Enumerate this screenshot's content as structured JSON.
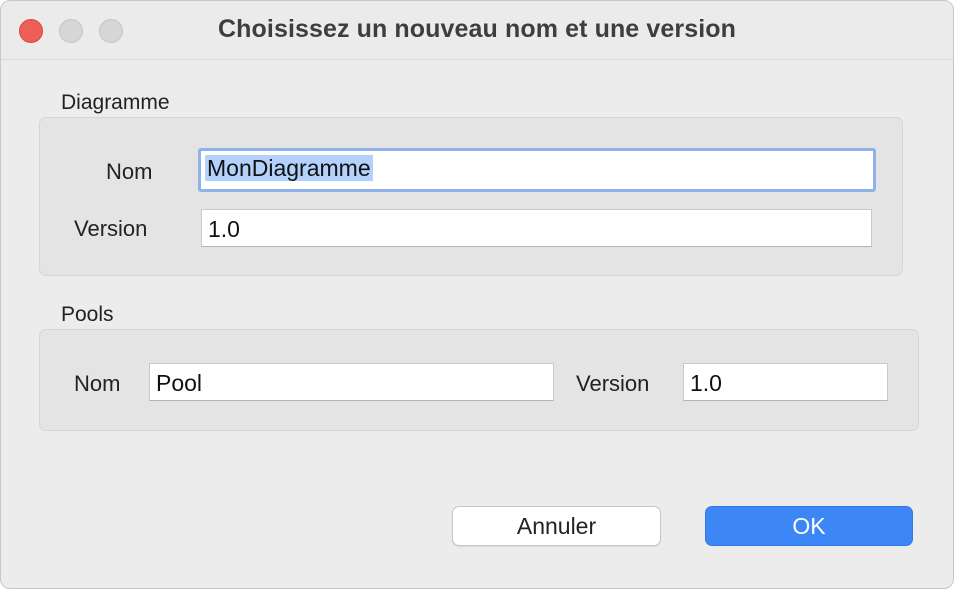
{
  "dialog": {
    "title": "Choisissez un nouveau nom et une version"
  },
  "diagram_section": {
    "label": "Diagramme",
    "name_label": "Nom",
    "name_value": "MonDiagramme",
    "version_label": "Version",
    "version_value": "1.0"
  },
  "pools_section": {
    "label": "Pools",
    "name_label": "Nom",
    "name_value": "Pool",
    "version_label": "Version",
    "version_value": "1.0"
  },
  "buttons": {
    "cancel_label": "Annuler",
    "ok_label": "OK"
  },
  "colors": {
    "accent": "#3d86f5",
    "selection": "#b3d1fb",
    "focus_ring": "#8fb2ea",
    "close_button": "#ee5f57"
  }
}
